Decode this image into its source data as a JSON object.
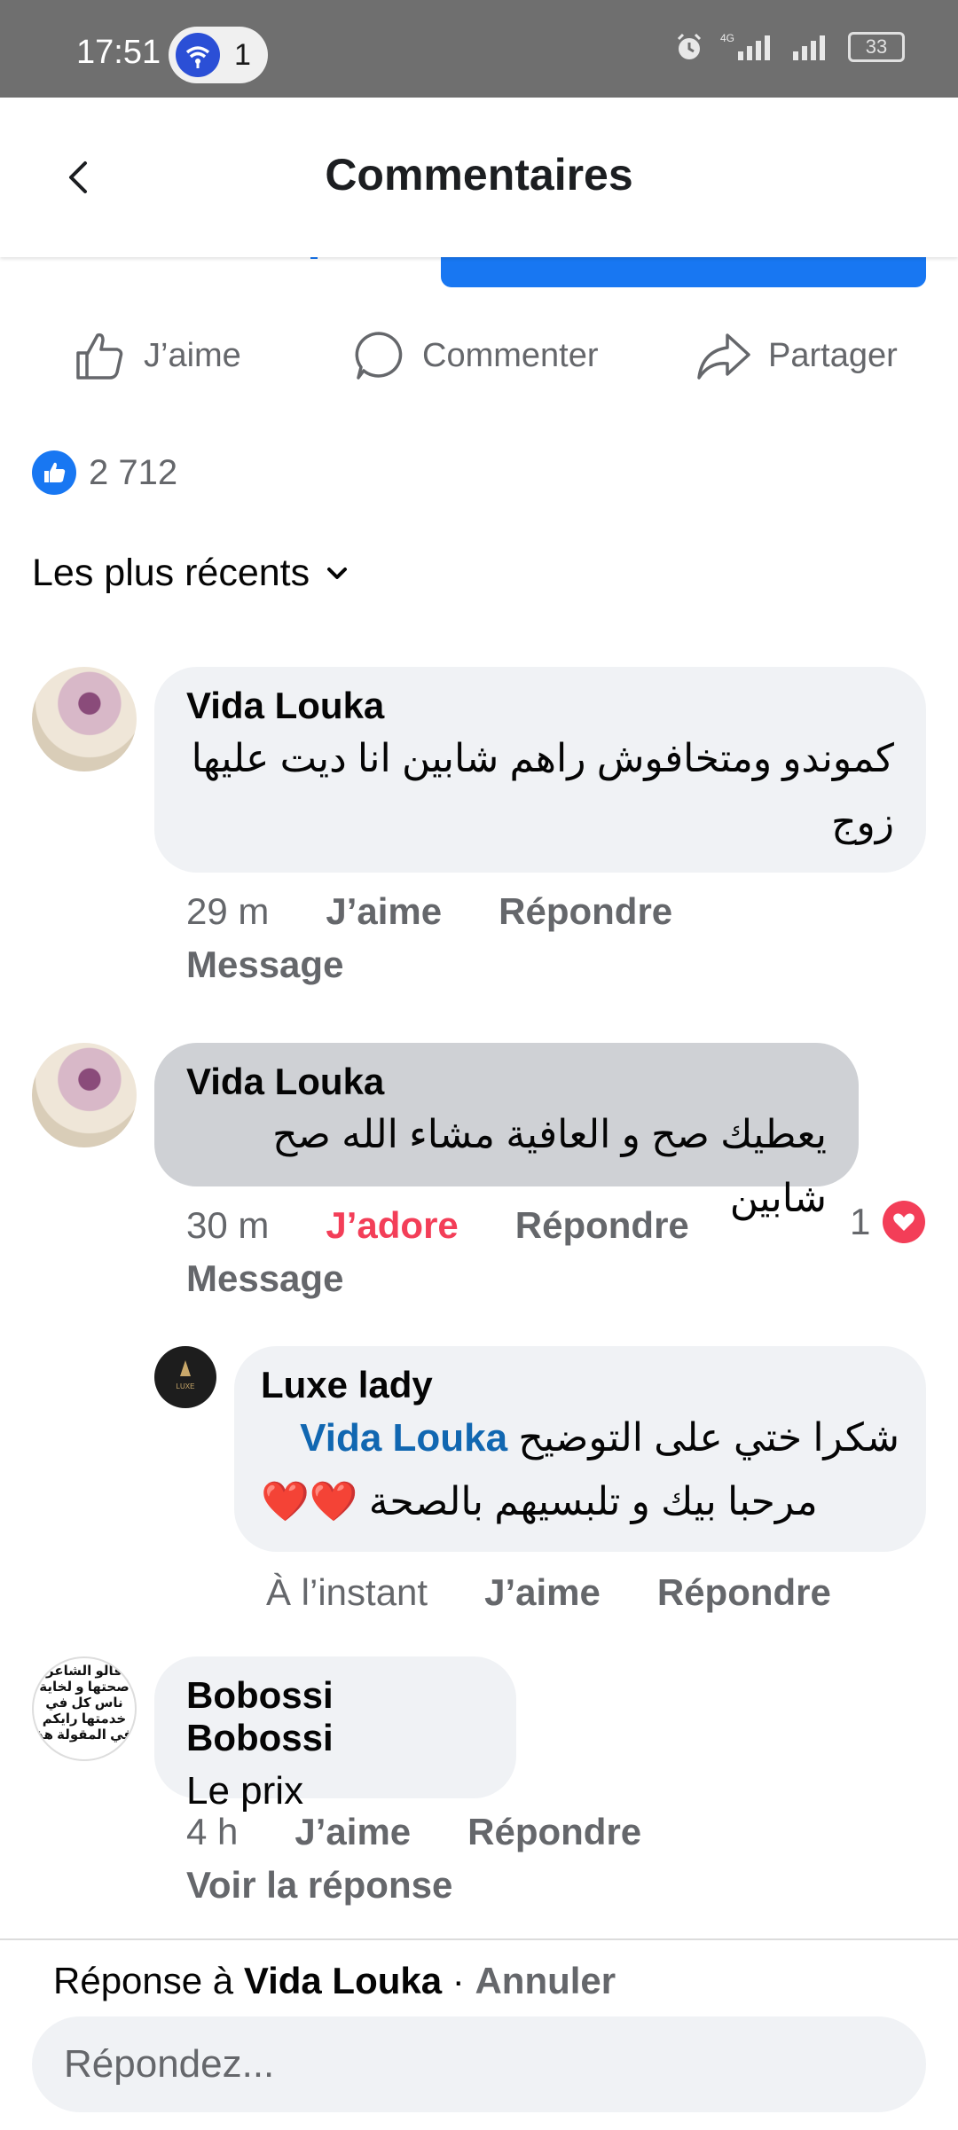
{
  "status_bar": {
    "time": "17:51",
    "notif_count": "1",
    "network": "4G",
    "battery": "33"
  },
  "header": {
    "title": "Commentaires"
  },
  "actions": {
    "like": "J’aime",
    "comment": "Commenter",
    "share": "Partager"
  },
  "reactions": {
    "count": "2 712"
  },
  "sort": {
    "label": "Les plus récents"
  },
  "comments": [
    {
      "author": "Vida Louka",
      "text": "كموندو ومتخافوش راهم شابين انا ديت عليها زوج",
      "time": "29 m",
      "like": "J’aime",
      "reply": "Répondre",
      "message": "Message"
    },
    {
      "author": "Vida Louka",
      "text": "يعطيك صح و العافية مشاء الله صح شابين",
      "time": "30 m",
      "like": "J’adore",
      "reply": "Répondre",
      "message": "Message",
      "reaction_count": "1"
    },
    {
      "author": "Luxe lady",
      "mention": "Vida Louka",
      "text_line1": "شكرا ختي على التوضيح",
      "text_line2": "مرحبا بيك و تلبسيهم بالصحة ❤️❤️",
      "time": "À l’instant",
      "like": "J’aime",
      "reply": "Répondre",
      "avatar_text": "LUXE"
    },
    {
      "author": "Bobossi Bobossi",
      "text": "Le prix",
      "time": "4 h",
      "like": "J’aime",
      "reply": "Répondre",
      "view_replies": "Voir la réponse",
      "avatar_text": "قالو الشاعر صحتها و لخاية ناس كل في خدمتها رايكم في المقولة هذ"
    }
  ],
  "reply_bar": {
    "prefix": "Réponse à",
    "target": "Vida Louka",
    "separator": "·",
    "cancel": "Annuler",
    "placeholder": "Répondez..."
  },
  "colors": {
    "accent": "#1877f2",
    "love": "#f33e58",
    "bubble": "#f0f2f5",
    "muted": "#65676b"
  }
}
